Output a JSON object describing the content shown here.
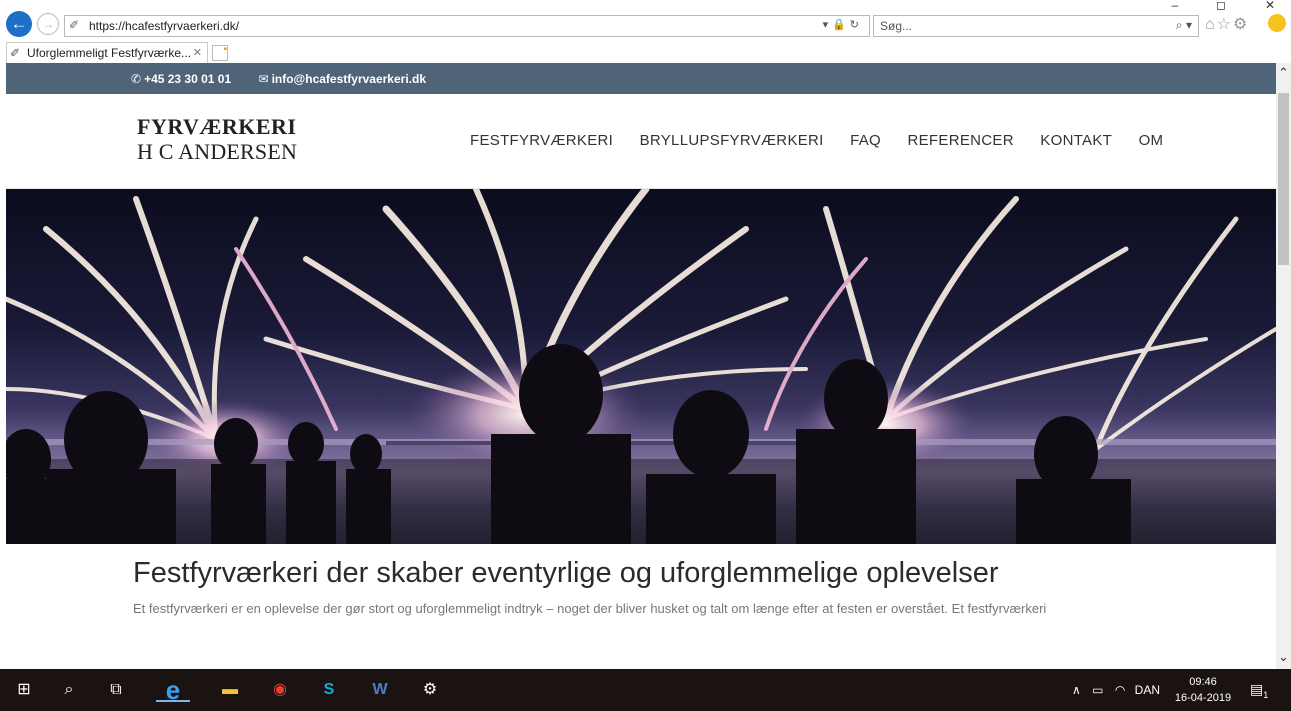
{
  "browser": {
    "url": "https://hcafestfyrvaerkeri.dk/",
    "search_placeholder": "Søg...",
    "tab_title": "Uforglemmeligt Festfyrværke...",
    "window_min": "–",
    "window_restore": "◻",
    "window_close": "✕"
  },
  "site": {
    "phone": "+45 23 30 01 01",
    "email": "info@hcafestfyrvaerkeri.dk",
    "logo_line1": "FYRVÆRKERI",
    "logo_line2": "H C ANDERSEN",
    "nav": [
      "FESTFYRVÆRKERI",
      "BRYLLUPSFYRVÆRKERI",
      "FAQ",
      "REFERENCER",
      "KONTAKT",
      "OM"
    ],
    "headline": "Festfyrværkeri der skaber eventyrlige og uforglemmelige oplevelser",
    "intro": "Et festfyrværkeri er en oplevelse der gør stort og uforglemmeligt indtryk – noget der bliver husket og talt om længe efter at festen er overstået. Et festfyrværkeri"
  },
  "taskbar": {
    "language": "DAN",
    "time": "09:46",
    "date": "16-04-2019",
    "notification_count": "1"
  }
}
